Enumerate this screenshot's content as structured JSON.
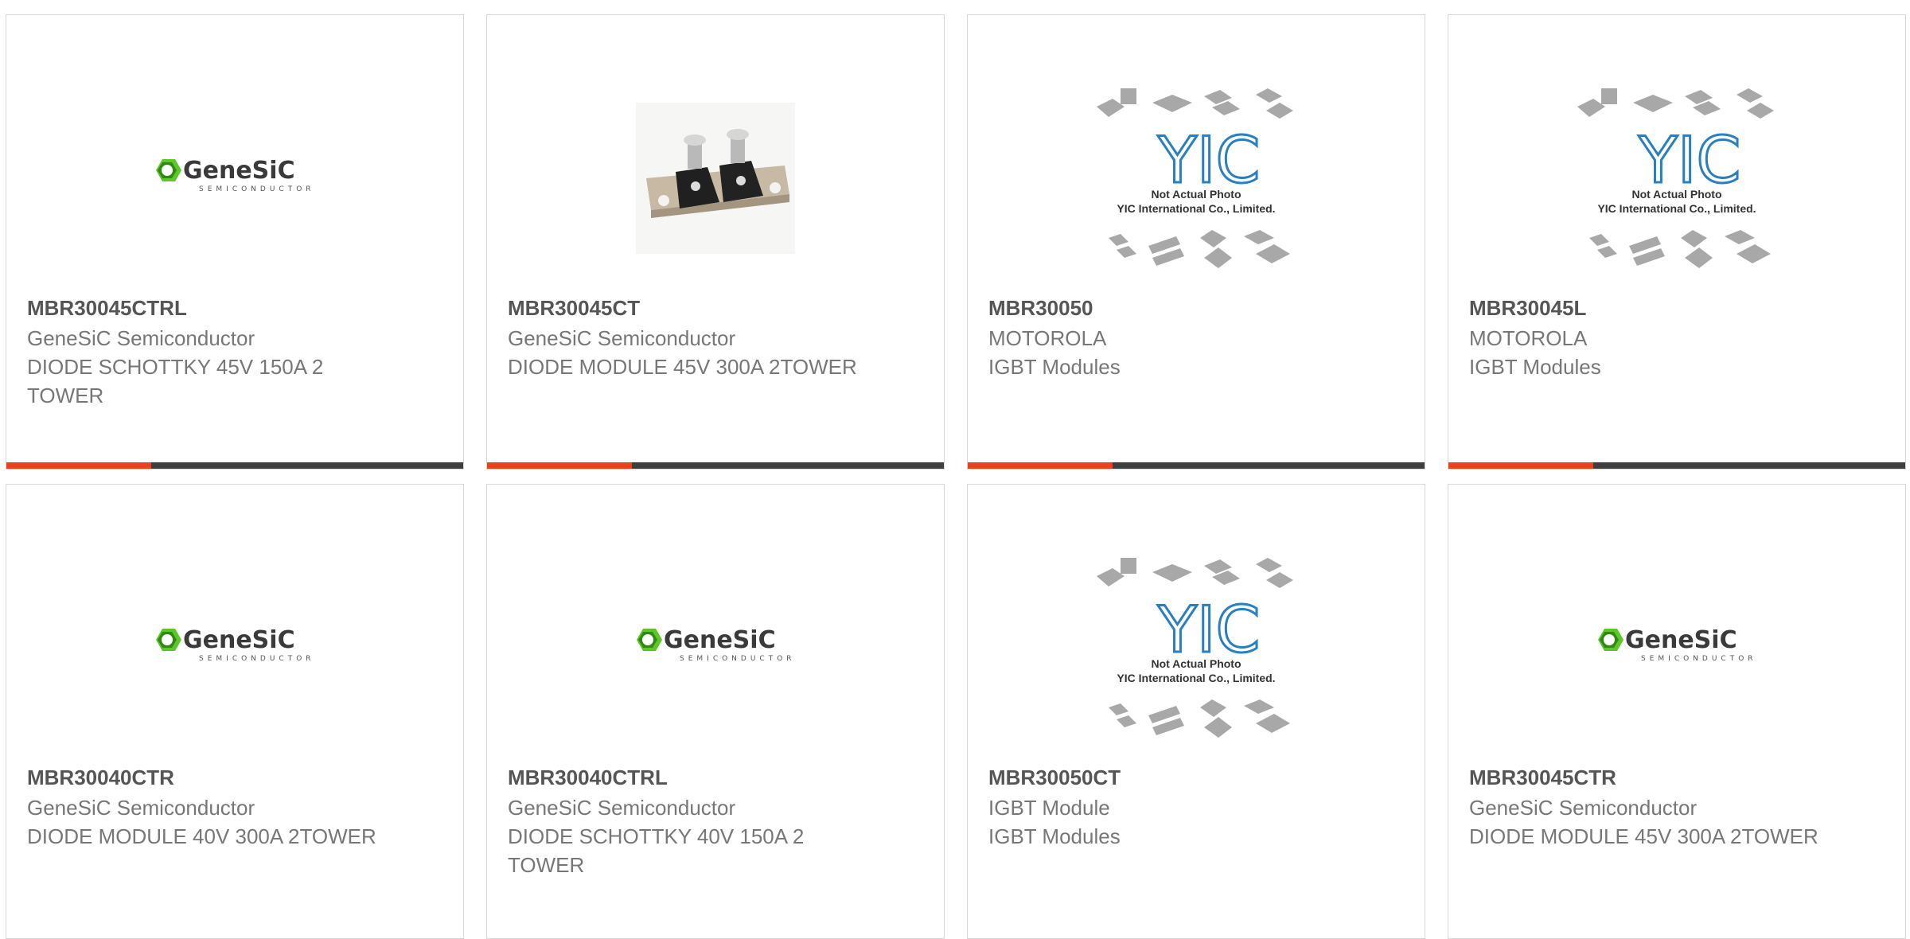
{
  "products": [
    {
      "part": "MBR30045CTRL",
      "mfr": "GeneSiC Semiconductor",
      "desc": "DIODE SCHOTTKY 45V 150A 2 TOWER",
      "image": "genesic-logo"
    },
    {
      "part": "MBR30045CT",
      "mfr": "GeneSiC Semiconductor",
      "desc": "DIODE MODULE 45V 300A 2TOWER",
      "image": "diode-module-photo"
    },
    {
      "part": "MBR30050",
      "mfr": "MOTOROLA",
      "desc": "IGBT Modules",
      "image": "yic-placeholder"
    },
    {
      "part": "MBR30045L",
      "mfr": "MOTOROLA",
      "desc": "IGBT Modules",
      "image": "yic-placeholder"
    },
    {
      "part": "MBR30040CTR",
      "mfr": "GeneSiC Semiconductor",
      "desc": "DIODE MODULE 40V 300A 2TOWER",
      "image": "genesic-logo"
    },
    {
      "part": "MBR30040CTRL",
      "mfr": "GeneSiC Semiconductor",
      "desc": "DIODE SCHOTTKY 40V 150A 2 TOWER",
      "image": "genesic-logo"
    },
    {
      "part": "MBR30050CT",
      "mfr": "IGBT Module",
      "desc": "IGBT Modules",
      "image": "yic-placeholder"
    },
    {
      "part": "MBR30045CTR",
      "mfr": "GeneSiC Semiconductor",
      "desc": "DIODE MODULE 45V 300A 2TOWER",
      "image": "genesic-logo"
    }
  ],
  "logos": {
    "genesic_name": "GeneSiC",
    "genesic_sub": "SEMICONDUCTOR",
    "yic_mark": "YIC",
    "yic_line1": "Not Actual Photo",
    "yic_line2": "YIC International Co., Limited."
  },
  "colors": {
    "accent": "#e8431c",
    "bar": "#3e3e3e",
    "genesic_green": "#4bb81f"
  }
}
